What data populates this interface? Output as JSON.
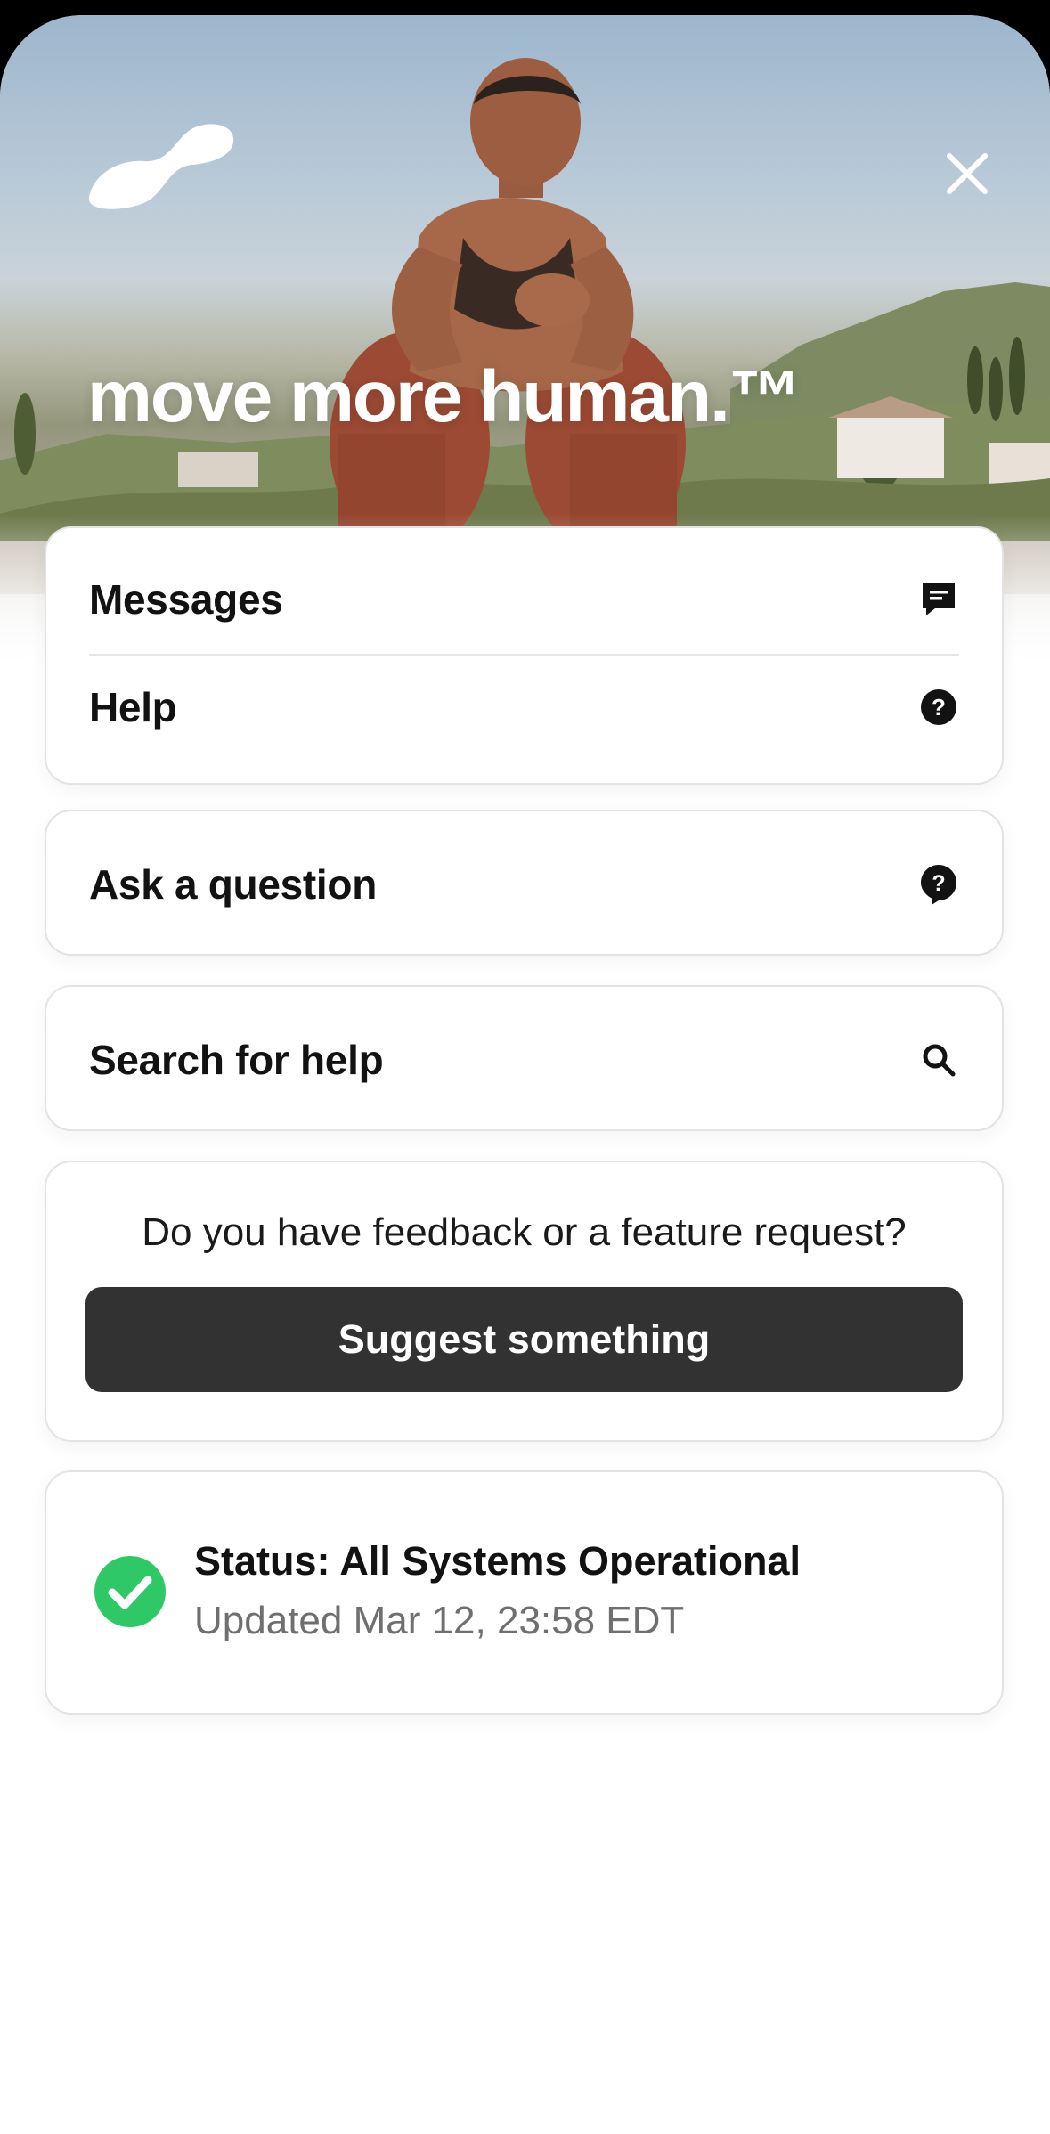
{
  "header": {
    "tagline": "move more human.™"
  },
  "menu": {
    "items": [
      {
        "label": "Messages",
        "icon": "message-icon"
      },
      {
        "label": "Help",
        "icon": "help-circle-icon"
      }
    ]
  },
  "ask": {
    "label": "Ask a question",
    "icon": "question-bubble-icon"
  },
  "search": {
    "label": "Search for help",
    "icon": "search-icon"
  },
  "feedback": {
    "prompt": "Do you have feedback or a feature request?",
    "button_label": "Suggest something"
  },
  "status": {
    "title": "Status: All Systems Operational",
    "updated": "Updated Mar 12, 23:58 EDT",
    "icon": "check-circle-icon",
    "color": "#2ec866"
  },
  "colors": {
    "button_bg": "#323232",
    "text": "#121212",
    "muted": "#6f6f6f"
  }
}
